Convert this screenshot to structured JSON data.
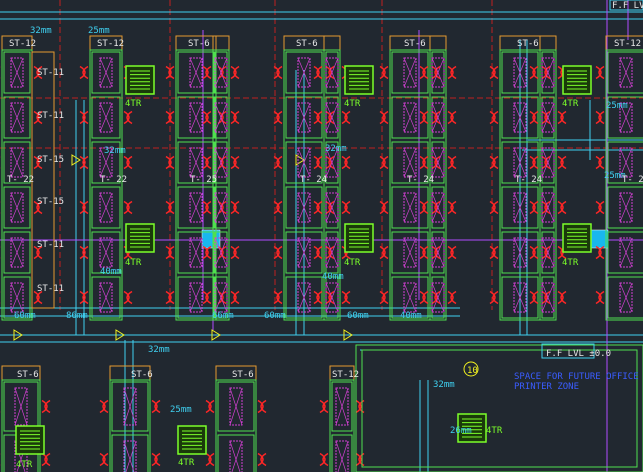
{
  "drawing": {
    "colors": {
      "background": "#212830",
      "wall": "#e59a2f",
      "workstation": "#4fe04f",
      "chair": "#ff2626",
      "cabinet": "#d340d3",
      "duct": "#3fd0f0",
      "grid": "#c02020",
      "ac_unit": "#7cff2a",
      "diffuser": "#19b7ee",
      "purple_line": "#b14bff"
    },
    "icon_names": [
      "ac-unit-icon",
      "chair-icon",
      "file-cabinet-icon",
      "duct-fitting-icon",
      "level-marker-icon"
    ]
  },
  "labels": {
    "duct_sizes": [
      "32mm",
      "25mm",
      "32mm",
      "40mm",
      "32mm",
      "40mm",
      "60mm",
      "86mm",
      "66mm",
      "60mm",
      "60mm",
      "40mm",
      "32mm",
      "25mm",
      "32mm",
      "26mm",
      "25mm",
      "25mm"
    ],
    "block_tags_top": [
      "ST-12",
      "ST-12",
      "ST-6",
      "ST-6",
      "ST-6",
      "ST-6",
      "ST-12"
    ],
    "side_tags": [
      "ST-11",
      "ST-11",
      "ST-15",
      "ST-15",
      "ST-11",
      "ST-11"
    ],
    "t_tags": [
      "T- 22",
      "T- 22",
      "T- 25",
      "T- 24",
      "T- 24",
      "T- 24",
      "T- 2"
    ],
    "ac_tags": [
      "4TR",
      "4TR",
      "4TR",
      "4TR",
      "4TR",
      "4TR",
      "4TR",
      "4TR",
      "4TR"
    ],
    "block_tags_bottom": [
      "ST-6",
      "ST-6",
      "ST-6",
      "ST-12"
    ],
    "level_top": "F.F LVL",
    "level_main": "F.F LVL ±0.0",
    "circle_tag": "10",
    "room_note_1": "SPACE FOR FUTURE OFFICE",
    "room_note_2": "PRINTER ZONE"
  }
}
